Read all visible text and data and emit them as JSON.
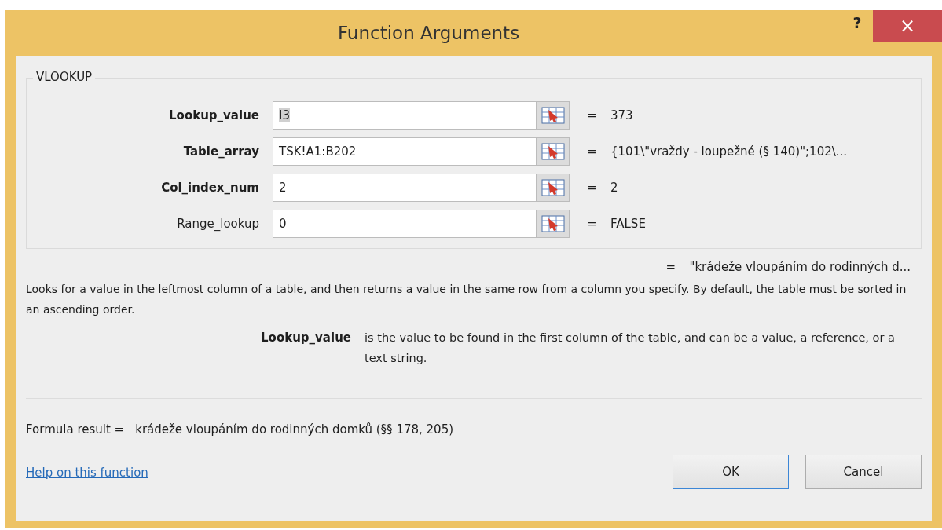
{
  "window": {
    "title": "Function Arguments",
    "help": "?",
    "close": "×"
  },
  "function_name": "VLOOKUP",
  "arguments": [
    {
      "label": "Lookup_value",
      "required": true,
      "value": "I3",
      "value_selected": true,
      "equals": "=",
      "result": "373"
    },
    {
      "label": "Table_array",
      "required": true,
      "value": "TSK!A1:B202",
      "value_selected": false,
      "equals": "=",
      "result": "{101\\\"vraždy - loupežné (§ 140)\";102\\..."
    },
    {
      "label": "Col_index_num",
      "required": true,
      "value": "2",
      "value_selected": false,
      "equals": "=",
      "result": "2"
    },
    {
      "label": "Range_lookup",
      "required": false,
      "value": "0",
      "value_selected": false,
      "equals": "=",
      "result": "FALSE"
    }
  ],
  "function_result_equals": "=",
  "function_result": "\"krádeže vloupáním do rodinných d...",
  "description": "Looks for a value in the leftmost column of a table, and then returns a value in the same row from a column you specify. By default, the table must be sorted in an ascending order.",
  "argument_help": {
    "name": "Lookup_value",
    "text": "is the value to be found in the first column of the table, and can be a value, a reference, or a text string."
  },
  "formula_result": {
    "label": "Formula result =",
    "value": "krádeže vloupáním do rodinných domků (§§ 178, 205)"
  },
  "help_link": "Help on this function",
  "buttons": [
    {
      "label": "OK",
      "default": true
    },
    {
      "label": "Cancel",
      "default": false
    }
  ]
}
